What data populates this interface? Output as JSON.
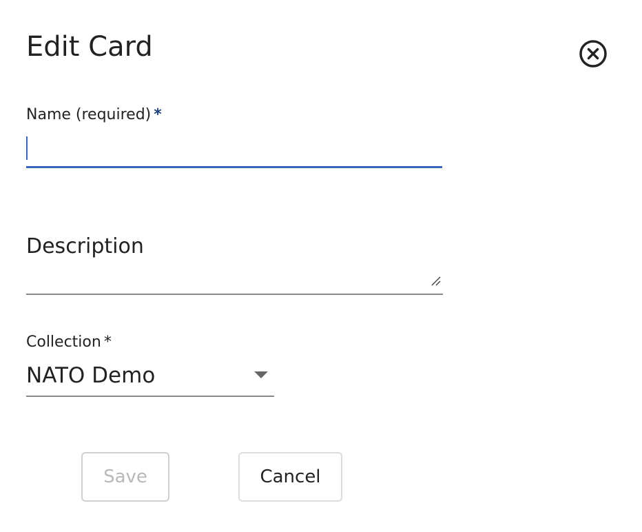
{
  "dialog": {
    "title": "Edit Card"
  },
  "form": {
    "name": {
      "label": "Name (required)",
      "required_marker": "*",
      "value": ""
    },
    "description": {
      "label": "Description",
      "value": ""
    },
    "collection": {
      "label": "Collection",
      "required_marker": "*",
      "selected": "NATO Demo"
    }
  },
  "buttons": {
    "save_label": "Save",
    "cancel_label": "Cancel"
  },
  "icons": {
    "close": "close-circle-icon",
    "dropdown": "caret-down-icon",
    "resize": "resize-handle-icon"
  },
  "colors": {
    "accent": "#3a64b5",
    "required_star": "#1f3f7a",
    "disabled_text": "#b8b8b8"
  }
}
